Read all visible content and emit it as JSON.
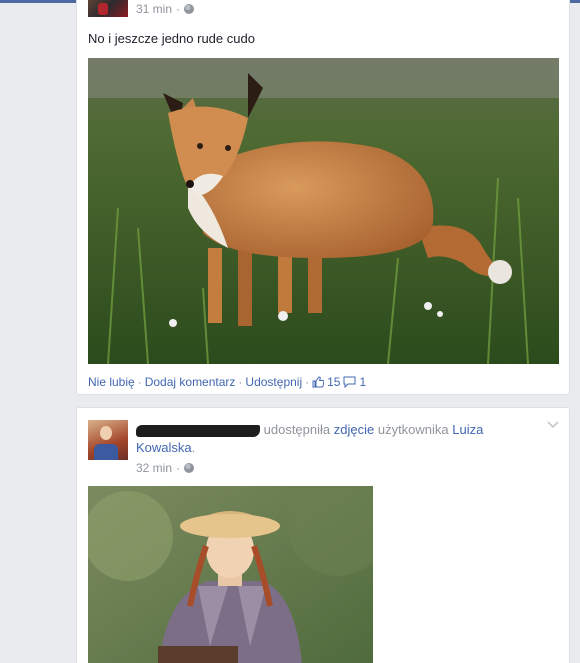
{
  "post1": {
    "time": "31 min",
    "privacy_icon": "globe-icon",
    "text": "No i jeszcze jedno rude cudo",
    "photo_subject": "fox",
    "actions": {
      "like": "Nie lubię",
      "comment": "Dodaj komentarz",
      "share": "Udostępnij",
      "separator": "·",
      "likes_count": "15",
      "comments_count": "1"
    }
  },
  "post2": {
    "action_text": "udostępniła",
    "photo_link": "zdjęcie",
    "user_text": "użytkownika",
    "user_name": "Luiza Kowalska",
    "end_dot": ".",
    "time": "32 min",
    "privacy_icon": "globe-icon",
    "photo_subject": "girl-in-straw-hat"
  },
  "colors": {
    "link": "#4267b2",
    "meta": "#90949c",
    "background": "#e9ebee"
  }
}
